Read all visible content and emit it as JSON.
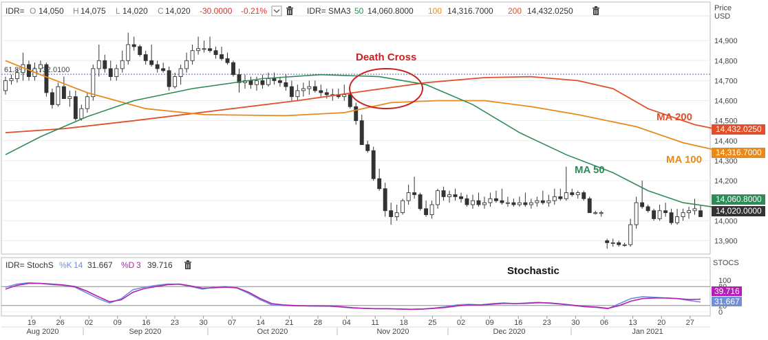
{
  "main_panel": {
    "ohlc": {
      "symbol": "IDR=",
      "o_label": "O",
      "o": "14,050",
      "h_label": "H",
      "h": "14,075",
      "l_label": "L",
      "l": "14,020",
      "c_label": "C",
      "c": "14,020",
      "change": "-30.0000",
      "change_pct": "-0.21%"
    },
    "sma": {
      "label": "IDR= SMA3",
      "p1": "50",
      "v1": "14,060.8000",
      "p2": "100",
      "v2": "14,316.7000",
      "p3": "200",
      "v3": "14,432.0250"
    },
    "axis_title_1": "Price",
    "axis_title_2": "USD",
    "fib_label": "61.8% 14,732.0100",
    "price_badges": {
      "ma200": "14,432.0250",
      "ma100": "14,316.7000",
      "ma50": "14,060.8000",
      "close": "14,020.0000"
    }
  },
  "annotations": {
    "death_cross": "Death Cross",
    "ma200": "MA 200",
    "ma100": "MA 100",
    "ma50": "MA 50",
    "stochastic": "Stochastic"
  },
  "stoch_panel": {
    "header": "IDR= StochS",
    "k_label": "%K",
    "k_period": "14",
    "k_value": "31.667",
    "d_label": "%D",
    "d_period": "3",
    "d_value": "39.716",
    "axis_title": "STOCS",
    "badges": {
      "d": "39.716",
      "k": "31.667"
    }
  },
  "colors": {
    "ma200": "#e0502a",
    "ma100": "#e8891a",
    "ma50": "#2e8b57",
    "death_cross": "#cc1f1f",
    "stoch_k": "#6f8fd6",
    "stoch_d": "#b21fb2",
    "down_text": "#e0302a",
    "fib": "#5a5ab4"
  },
  "chart_data": [
    {
      "type": "candlestick",
      "x_axis": {
        "day_ticks": [
          "19",
          "26",
          "02",
          "09",
          "16",
          "23",
          "30",
          "07",
          "14",
          "21",
          "28",
          "04",
          "11",
          "18",
          "25",
          "02",
          "09",
          "16",
          "23",
          "30",
          "06",
          "13",
          "20",
          "27"
        ],
        "months": [
          "Aug 2020",
          "Sep 2020",
          "Oct 2020",
          "Nov 2020",
          "Dec 2020",
          "Jan 2021"
        ]
      },
      "y_axis": {
        "ticks": [
          "14,900",
          "14,800",
          "14,700",
          "14,600",
          "14,500",
          "14,400",
          "14,300",
          "14,200",
          "14,100",
          "14,000",
          "13,900"
        ],
        "range": [
          13850,
          15000
        ]
      },
      "horizontal_level": 14732.01,
      "candles": [
        [
          14650,
          14720,
          14630,
          14700
        ],
        [
          14700,
          14730,
          14680,
          14710
        ],
        [
          14710,
          14760,
          14690,
          14740
        ],
        [
          14740,
          14840,
          14700,
          14780
        ],
        [
          14780,
          14800,
          14700,
          14720
        ],
        [
          14720,
          14790,
          14700,
          14760
        ],
        [
          14760,
          14800,
          14740,
          14780
        ],
        [
          14780,
          14790,
          14620,
          14640
        ],
        [
          14640,
          14660,
          14560,
          14580
        ],
        [
          14580,
          14690,
          14570,
          14670
        ],
        [
          14670,
          14720,
          14620,
          14610
        ],
        [
          14610,
          14650,
          14570,
          14620
        ],
        [
          14620,
          14650,
          14500,
          14510
        ],
        [
          14510,
          14580,
          14500,
          14560
        ],
        [
          14560,
          14640,
          14540,
          14620
        ],
        [
          14620,
          14780,
          14600,
          14760
        ],
        [
          14760,
          14880,
          14720,
          14800
        ],
        [
          14800,
          14830,
          14740,
          14760
        ],
        [
          14760,
          14800,
          14700,
          14720
        ],
        [
          14720,
          14780,
          14700,
          14760
        ],
        [
          14760,
          14850,
          14740,
          14800
        ],
        [
          14800,
          14940,
          14780,
          14880
        ],
        [
          14880,
          14920,
          14850,
          14870
        ],
        [
          14870,
          14880,
          14820,
          14830
        ],
        [
          14830,
          14850,
          14780,
          14800
        ],
        [
          14800,
          14880,
          14770,
          14780
        ],
        [
          14780,
          14800,
          14740,
          14760
        ],
        [
          14760,
          14790,
          14740,
          14750
        ],
        [
          14750,
          14770,
          14650,
          14670
        ],
        [
          14670,
          14740,
          14660,
          14720
        ],
        [
          14720,
          14780,
          14680,
          14760
        ],
        [
          14760,
          14840,
          14740,
          14800
        ],
        [
          14800,
          14880,
          14780,
          14850
        ],
        [
          14850,
          14920,
          14830,
          14860
        ],
        [
          14860,
          14900,
          14840,
          14860
        ],
        [
          14860,
          14920,
          14840,
          14850
        ],
        [
          14850,
          14870,
          14810,
          14830
        ],
        [
          14830,
          14870,
          14800,
          14810
        ],
        [
          14810,
          14840,
          14780,
          14790
        ],
        [
          14790,
          14800,
          14720,
          14730
        ],
        [
          14730,
          14760,
          14640,
          14690
        ],
        [
          14690,
          14730,
          14660,
          14700
        ],
        [
          14700,
          14720,
          14660,
          14680
        ],
        [
          14680,
          14720,
          14650,
          14700
        ],
        [
          14700,
          14730,
          14660,
          14680
        ],
        [
          14680,
          14740,
          14670,
          14710
        ],
        [
          14710,
          14740,
          14680,
          14700
        ],
        [
          14700,
          14720,
          14670,
          14690
        ],
        [
          14690,
          14730,
          14650,
          14670
        ],
        [
          14670,
          14700,
          14600,
          14620
        ],
        [
          14620,
          14680,
          14600,
          14650
        ],
        [
          14650,
          14690,
          14620,
          14660
        ],
        [
          14660,
          14700,
          14630,
          14670
        ],
        [
          14670,
          14700,
          14640,
          14650
        ],
        [
          14650,
          14680,
          14620,
          14640
        ],
        [
          14640,
          14660,
          14610,
          14630
        ],
        [
          14630,
          14660,
          14600,
          14630
        ],
        [
          14630,
          14660,
          14610,
          14620
        ],
        [
          14620,
          14680,
          14600,
          14630
        ],
        [
          14630,
          14650,
          14560,
          14570
        ],
        [
          14570,
          14590,
          14480,
          14500
        ],
        [
          14500,
          14530,
          14400,
          14380
        ],
        [
          14380,
          14400,
          14340,
          14350
        ],
        [
          14350,
          14370,
          14200,
          14210
        ],
        [
          14210,
          14260,
          14150,
          14160
        ],
        [
          14160,
          14190,
          14020,
          14050
        ],
        [
          14050,
          14090,
          13980,
          14020
        ],
        [
          14020,
          14080,
          14000,
          14040
        ],
        [
          14040,
          14110,
          14030,
          14100
        ],
        [
          14100,
          14180,
          14080,
          14140
        ],
        [
          14140,
          14220,
          14110,
          14130
        ],
        [
          14130,
          14140,
          14050,
          14060
        ],
        [
          14060,
          14100,
          14020,
          14030
        ],
        [
          14030,
          14100,
          14010,
          14080
        ],
        [
          14080,
          14160,
          14060,
          14150
        ],
        [
          14150,
          14170,
          14100,
          14120
        ],
        [
          14120,
          14150,
          14090,
          14130
        ],
        [
          14130,
          14160,
          14100,
          14120
        ],
        [
          14120,
          14140,
          14090,
          14110
        ],
        [
          14110,
          14130,
          14070,
          14080
        ],
        [
          14080,
          14130,
          14060,
          14100
        ],
        [
          14100,
          14140,
          14070,
          14080
        ],
        [
          14080,
          14120,
          14060,
          14090
        ],
        [
          14090,
          14140,
          14070,
          14110
        ],
        [
          14110,
          14150,
          14090,
          14100
        ],
        [
          14100,
          14160,
          14080,
          14090
        ],
        [
          14090,
          14120,
          14070,
          14090
        ],
        [
          14090,
          14110,
          14070,
          14080
        ],
        [
          14080,
          14120,
          14070,
          14090
        ],
        [
          14090,
          14140,
          14070,
          14080
        ],
        [
          14080,
          14110,
          14060,
          14090
        ],
        [
          14090,
          14120,
          14070,
          14100
        ],
        [
          14100,
          14150,
          14080,
          14090
        ],
        [
          14090,
          14130,
          14070,
          14100
        ],
        [
          14100,
          14160,
          14080,
          14120
        ],
        [
          14120,
          14160,
          14100,
          14110
        ],
        [
          14110,
          14270,
          14100,
          14140
        ],
        [
          14140,
          14160,
          14120,
          14130
        ],
        [
          14130,
          14150,
          14110,
          14140
        ],
        [
          14140,
          14150,
          14100,
          14110
        ],
        [
          14110,
          14120,
          14040,
          14040
        ],
        [
          14040,
          14050,
          14030,
          14040
        ],
        [
          14040,
          14050,
          14020,
          14040
        ],
        [
          13900,
          13910,
          13860,
          13890
        ],
        [
          13890,
          13910,
          13870,
          13890
        ],
        [
          13890,
          13900,
          13870,
          13880
        ],
        [
          13880,
          13890,
          13870,
          13880
        ],
        [
          13880,
          14010,
          13870,
          13980
        ],
        [
          13980,
          14120,
          13960,
          14090
        ],
        [
          14090,
          14200,
          14060,
          14070
        ],
        [
          14070,
          14080,
          14040,
          14050
        ],
        [
          14050,
          14060,
          14000,
          14010
        ],
        [
          14010,
          14080,
          14000,
          14050
        ],
        [
          14050,
          14090,
          14020,
          14040
        ],
        [
          14040,
          14060,
          13980,
          13990
        ],
        [
          13990,
          14060,
          13980,
          14020
        ],
        [
          14020,
          14060,
          14000,
          14040
        ],
        [
          14040,
          14070,
          14010,
          14050
        ],
        [
          14050,
          14110,
          14030,
          14060
        ],
        [
          14050,
          14075,
          14020,
          14020
        ]
      ],
      "ma50": [
        {
          "x": 0,
          "y": 14330
        },
        {
          "x": 6,
          "y": 14420
        },
        {
          "x": 14,
          "y": 14520
        },
        {
          "x": 22,
          "y": 14600
        },
        {
          "x": 32,
          "y": 14660
        },
        {
          "x": 44,
          "y": 14710
        },
        {
          "x": 54,
          "y": 14730
        },
        {
          "x": 64,
          "y": 14720
        },
        {
          "x": 72,
          "y": 14680
        },
        {
          "x": 80,
          "y": 14580
        },
        {
          "x": 88,
          "y": 14440
        },
        {
          "x": 96,
          "y": 14330
        },
        {
          "x": 104,
          "y": 14240
        },
        {
          "x": 110,
          "y": 14150
        },
        {
          "x": 116,
          "y": 14090
        },
        {
          "x": 122,
          "y": 14065
        },
        {
          "x": 126,
          "y": 14061
        }
      ],
      "ma100": [
        {
          "x": 0,
          "y": 14800
        },
        {
          "x": 6,
          "y": 14730
        },
        {
          "x": 14,
          "y": 14640
        },
        {
          "x": 24,
          "y": 14560
        },
        {
          "x": 34,
          "y": 14530
        },
        {
          "x": 48,
          "y": 14525
        },
        {
          "x": 58,
          "y": 14540
        },
        {
          "x": 66,
          "y": 14590
        },
        {
          "x": 74,
          "y": 14600
        },
        {
          "x": 82,
          "y": 14600
        },
        {
          "x": 90,
          "y": 14570
        },
        {
          "x": 98,
          "y": 14530
        },
        {
          "x": 108,
          "y": 14470
        },
        {
          "x": 116,
          "y": 14390
        },
        {
          "x": 122,
          "y": 14350
        },
        {
          "x": 126,
          "y": 14317
        }
      ],
      "ma200": [
        {
          "x": 0,
          "y": 14440
        },
        {
          "x": 10,
          "y": 14460
        },
        {
          "x": 22,
          "y": 14500
        },
        {
          "x": 36,
          "y": 14550
        },
        {
          "x": 50,
          "y": 14600
        },
        {
          "x": 62,
          "y": 14650
        },
        {
          "x": 72,
          "y": 14690
        },
        {
          "x": 82,
          "y": 14715
        },
        {
          "x": 90,
          "y": 14720
        },
        {
          "x": 98,
          "y": 14700
        },
        {
          "x": 104,
          "y": 14660
        },
        {
          "x": 110,
          "y": 14560
        },
        {
          "x": 118,
          "y": 14480
        },
        {
          "x": 126,
          "y": 14432
        }
      ]
    },
    {
      "type": "line",
      "y_axis": {
        "ticks": [
          "100",
          "80",
          "20",
          "0"
        ],
        "range": [
          0,
          100
        ]
      },
      "series": [
        {
          "name": "%K",
          "y": [
            78,
            88,
            92,
            90,
            86,
            84,
            78,
            60,
            42,
            28,
            42,
            70,
            78,
            84,
            88,
            87,
            80,
            72,
            78,
            80,
            75,
            58,
            38,
            22,
            20,
            19,
            19,
            18,
            18,
            15,
            12,
            11,
            10,
            10,
            9,
            8,
            9,
            12,
            16,
            22,
            24,
            22,
            26,
            28,
            26,
            28,
            30,
            27,
            24,
            20,
            16,
            14,
            10,
            26,
            42,
            48,
            46,
            44,
            42,
            36,
            31
          ]
        },
        {
          "name": "%D",
          "y": [
            72,
            84,
            90,
            90,
            88,
            85,
            80,
            66,
            48,
            32,
            38,
            62,
            74,
            80,
            86,
            88,
            82,
            75,
            76,
            78,
            76,
            62,
            42,
            26,
            22,
            20,
            19,
            19,
            18,
            16,
            13,
            11,
            10,
            10,
            9,
            8,
            9,
            11,
            14,
            19,
            22,
            22,
            24,
            27,
            26,
            27,
            29,
            28,
            25,
            21,
            17,
            15,
            11,
            20,
            34,
            42,
            44,
            44,
            42,
            39,
            40
          ]
        }
      ]
    }
  ]
}
